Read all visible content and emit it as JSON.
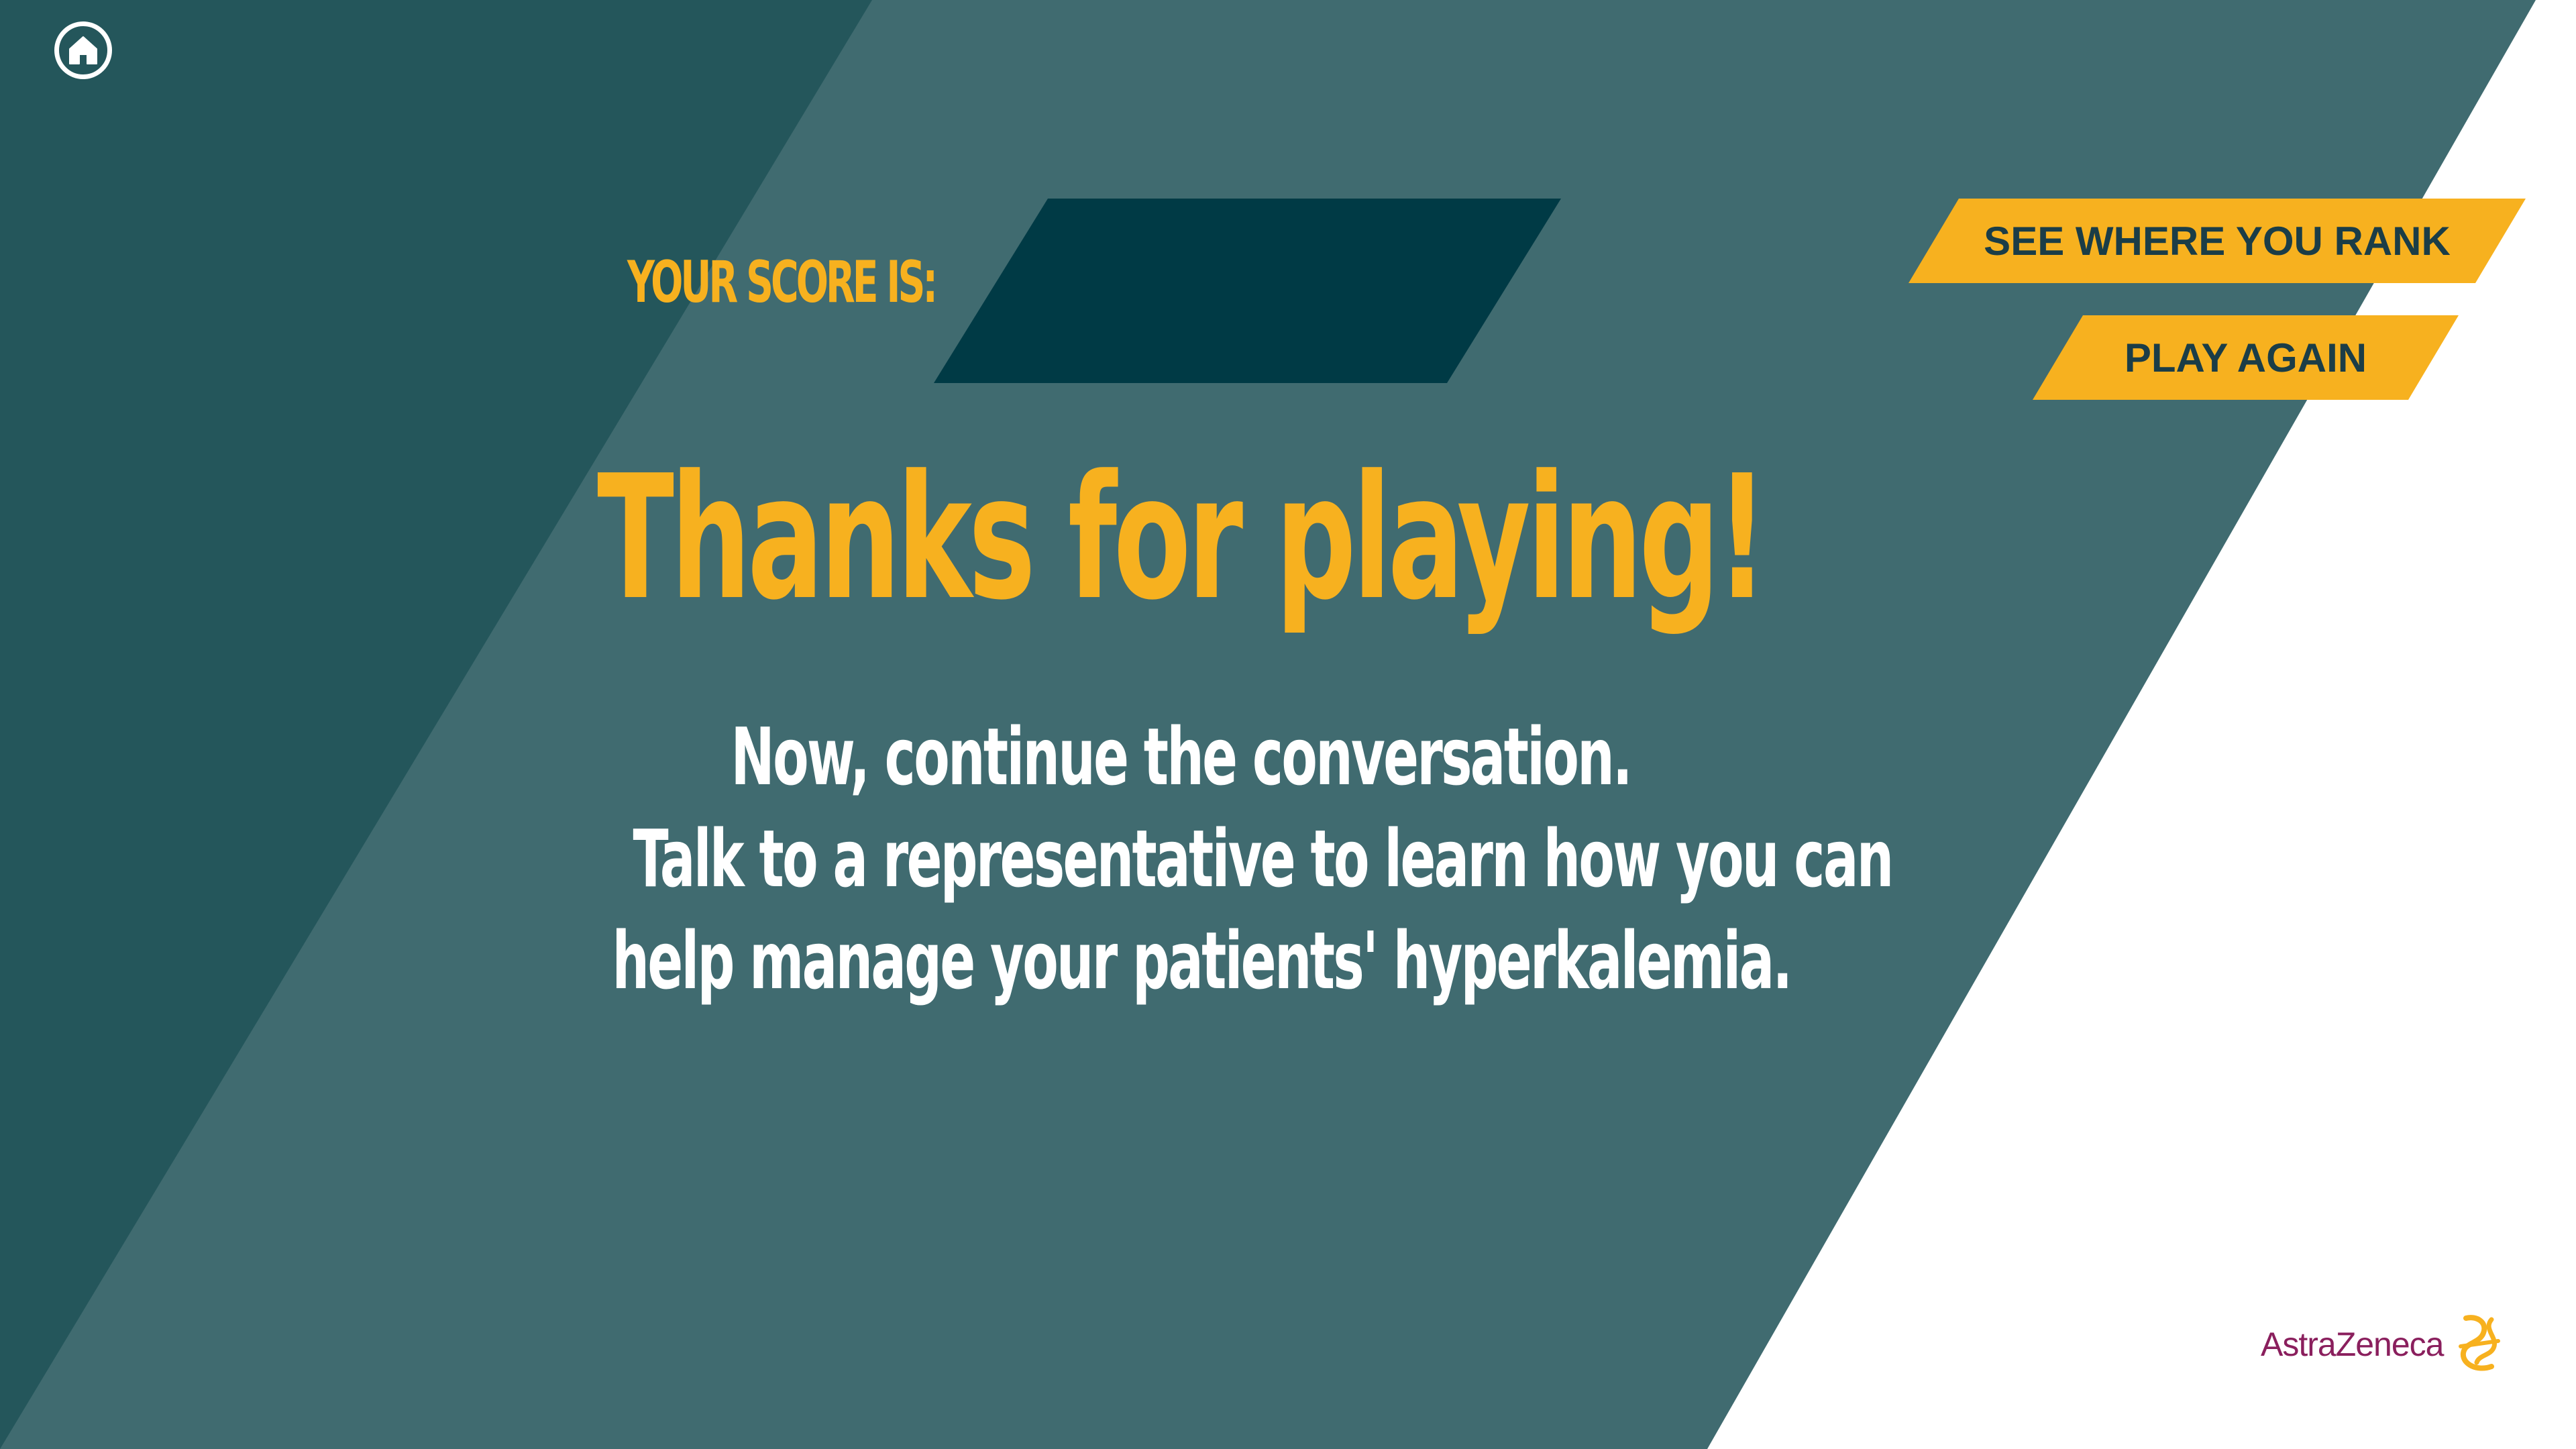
{
  "home": {
    "icon": "home-icon"
  },
  "score": {
    "label": "YOUR SCORE IS:",
    "value": ""
  },
  "headline": "Thanks for playing!",
  "message": {
    "line1": "Now, continue the conversation.",
    "line2": "Talk to a representative to learn how you can",
    "line3": "help manage your patients' hyperkalemia."
  },
  "buttons": {
    "see_rank": "SEE WHERE YOU RANK",
    "play_again": "PLAY AGAIN"
  },
  "brand": {
    "name": "AstraZeneca"
  },
  "colors": {
    "dark_teal": "#24565b",
    "mid_teal": "#406b70",
    "score_box": "#003a45",
    "accent_yellow": "#f7b11f",
    "button_text": "#1b3d47",
    "brand_magenta": "#8a1f5d",
    "white": "#ffffff"
  }
}
